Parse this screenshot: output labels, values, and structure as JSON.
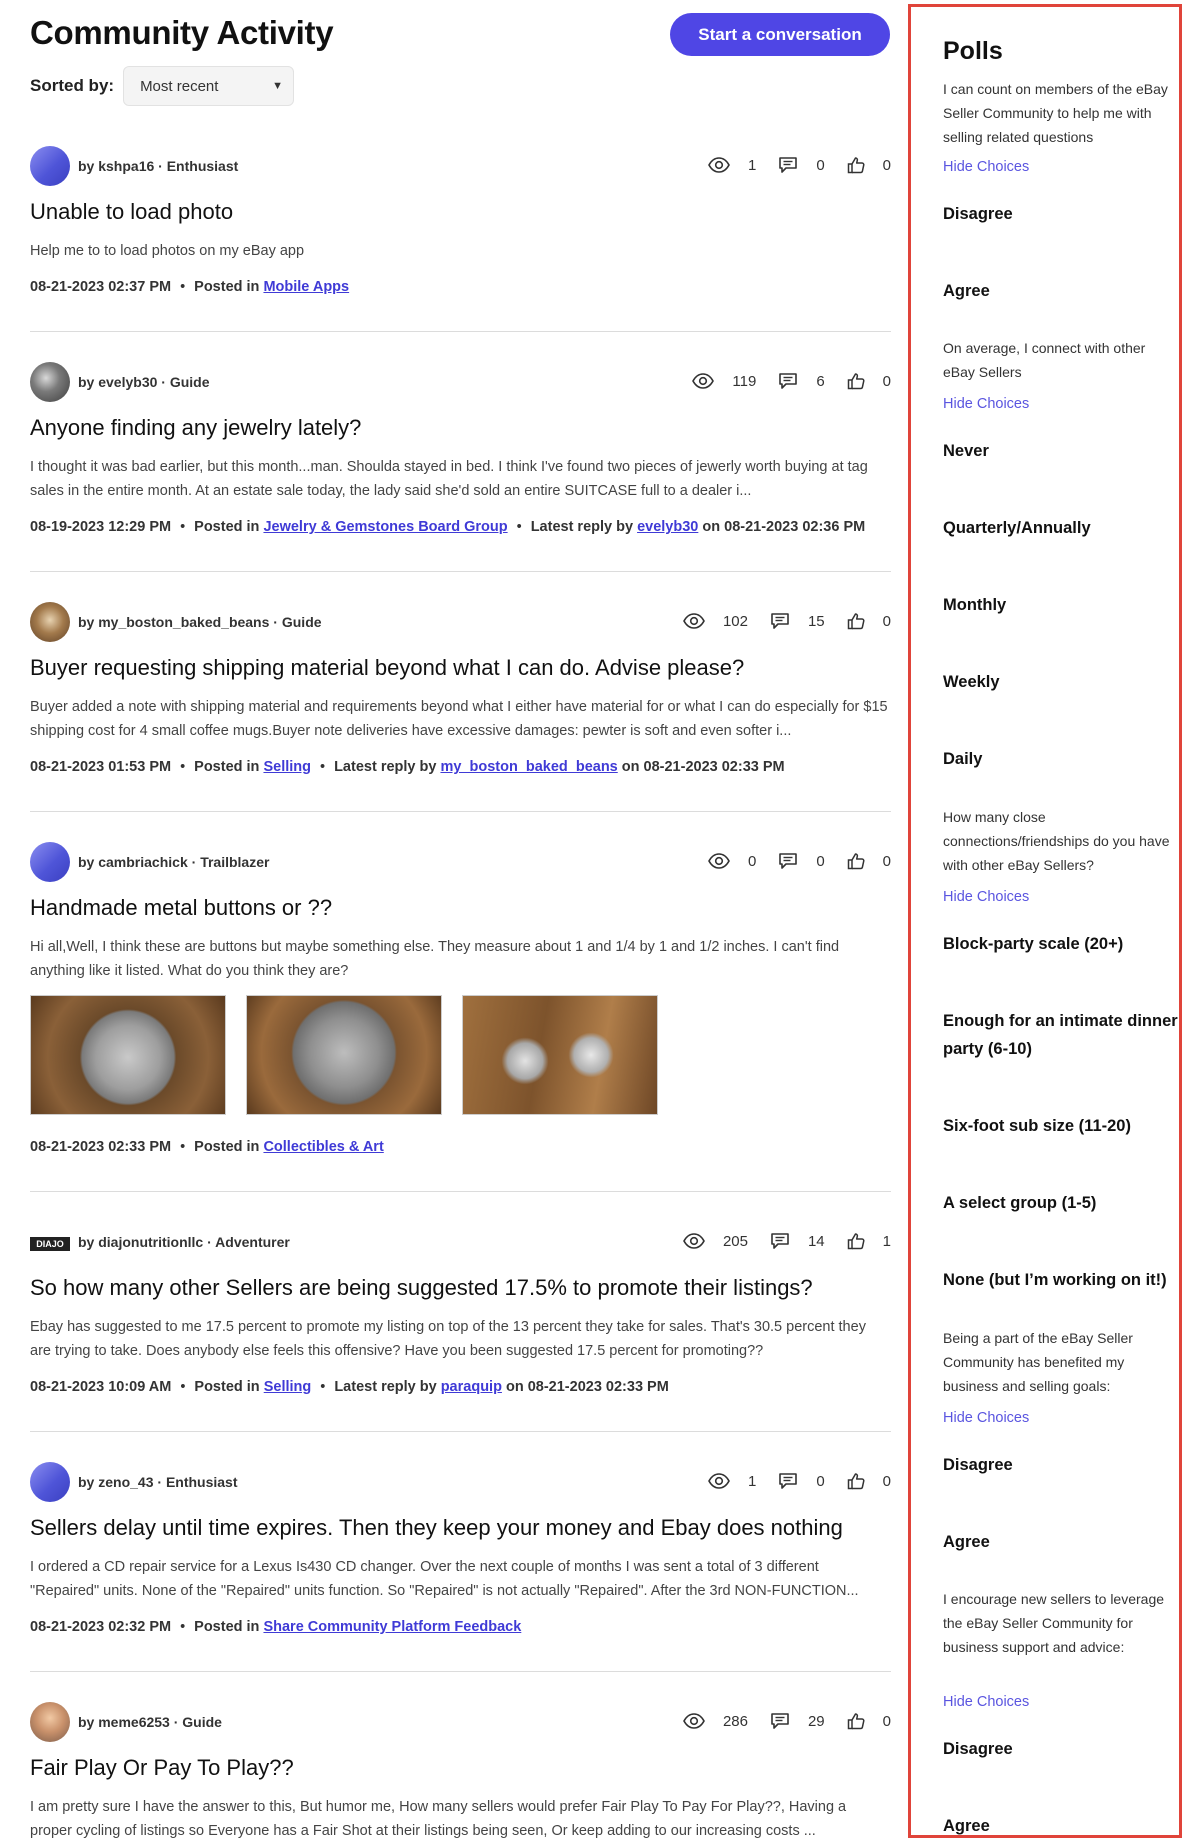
{
  "header": {
    "title": "Community Activity",
    "start_label": "Start a conversation",
    "sort_label": "Sorted by:",
    "sort_value": "Most recent"
  },
  "labels": {
    "posted_in": "Posted in",
    "latest_reply_by": "Latest reply by",
    "on": "on"
  },
  "posts": [
    {
      "author": "by kshpa16",
      "rank": "Enthusiast",
      "views": "1",
      "replies": "0",
      "kudos": "0",
      "title": "Unable to load photo",
      "body": "Help me to to load photos on my eBay app",
      "date": "08-21-2023 02:37 PM",
      "board": "Mobile Apps"
    },
    {
      "author": "by evelyb30",
      "rank": "Guide",
      "views": "119",
      "replies": "6",
      "kudos": "0",
      "title": "Anyone finding any jewelry lately?",
      "body": "I thought it was bad earlier, but this month...man. Shoulda stayed in bed. I think I've found two pieces of jewerly worth buying at tag sales in the entire month. At an estate sale today, the lady said she'd sold an entire SUITCASE full to a dealer i...",
      "date": "08-19-2023 12:29 PM",
      "board": "Jewelry & Gemstones Board Group",
      "reply_user": "evelyb30",
      "reply_date": "08-21-2023 02:36 PM"
    },
    {
      "author": "by my_boston_baked_beans",
      "rank": "Guide",
      "views": "102",
      "replies": "15",
      "kudos": "0",
      "title": "Buyer requesting shipping material beyond what I can do. Advise please?",
      "body": "Buyer added a note with shipping material and requirements beyond what I either have material for or what I can do especially for $15 shipping cost for 4 small coffee mugs.Buyer note deliveries have excessive damages: pewter is soft and even softer i...",
      "date": "08-21-2023 01:53 PM",
      "board": "Selling",
      "reply_user": "my_boston_baked_beans",
      "reply_date": "08-21-2023 02:33 PM"
    },
    {
      "author": "by cambriachick",
      "rank": "Trailblazer",
      "views": "0",
      "replies": "0",
      "kudos": "0",
      "title": "Handmade metal buttons or ??",
      "body": "Hi all,Well, I think these are buttons but maybe something else. They measure about 1 and 1/4 by 1 and 1/2 inches. I can't find anything like it listed. What do you think they are?",
      "date": "08-21-2023 02:33 PM",
      "board": "Collectibles & Art"
    },
    {
      "author": "by diajonutritionllc",
      "rank": "Adventurer",
      "avatar_text": "DIAJO",
      "views": "205",
      "replies": "14",
      "kudos": "1",
      "title": "So how many other Sellers are being suggested 17.5% to promote their listings?",
      "body": "Ebay has suggested to me 17.5 percent to promote my listing on top of the 13 percent they take for sales. That's 30.5 percent they are trying to take. Does anybody else feels this offensive? Have you been suggested 17.5 percent for promoting??",
      "date": "08-21-2023 10:09 AM",
      "board": "Selling",
      "reply_user": "paraquip",
      "reply_date": "08-21-2023 02:33 PM"
    },
    {
      "author": "by zeno_43",
      "rank": "Enthusiast",
      "views": "1",
      "replies": "0",
      "kudos": "0",
      "title": "Sellers delay until time expires. Then they keep your money and Ebay does nothing",
      "body": "I ordered a CD repair service for a Lexus Is430 CD changer. Over the next couple of months I was sent a total of 3 different \"Repaired\" units. None of the \"Repaired\" units function. So \"Repaired\" is not actually \"Repaired\". After the 3rd NON-FUNCTION...",
      "date": "08-21-2023 02:32 PM",
      "board": "Share Community Platform Feedback"
    },
    {
      "author": "by meme6253",
      "rank": "Guide",
      "views": "286",
      "replies": "29",
      "kudos": "0",
      "title": "Fair Play Or Pay To Play??",
      "body": "I am pretty sure I have the answer to this, But humor me, How many sellers would prefer Fair Play To Pay For Play??, Having a proper cycling of listings so Everyone has a Fair Shot at their listings being seen, Or keep adding to our increasing costs ..."
    }
  ],
  "polls": {
    "title": "Polls",
    "hide_label": "Hide Choices",
    "questions": [
      {
        "text": "I can count on members of the eBay Seller Community to help me with selling related questions",
        "choices": [
          "Disagree",
          "Agree"
        ]
      },
      {
        "text": "On average, I connect with other eBay Sellers",
        "choices": [
          "Never",
          "Quarterly/Annually",
          "Monthly",
          "Weekly",
          "Daily"
        ]
      },
      {
        "text": "How many close connections/friendships do you have with other eBay Sellers?",
        "choices": [
          "Block-party scale (20+)",
          "Enough for an intimate dinner party (6-10)",
          "Six-foot sub size (11-20)",
          "A select group (1-5)",
          "None (but I’m working on it!)"
        ]
      },
      {
        "text": "Being a part of the eBay Seller Community has benefited my business and selling goals:",
        "choices": [
          "Disagree",
          "Agree"
        ]
      },
      {
        "text": "I encourage new sellers to leverage the eBay Seller Community for business support and advice:",
        "choices": [
          "Disagree",
          "Agree"
        ]
      }
    ]
  },
  "colors": {
    "accent": "#4f46e5",
    "link": "#3f3ad6",
    "sidebar_border": "#e0443a"
  }
}
